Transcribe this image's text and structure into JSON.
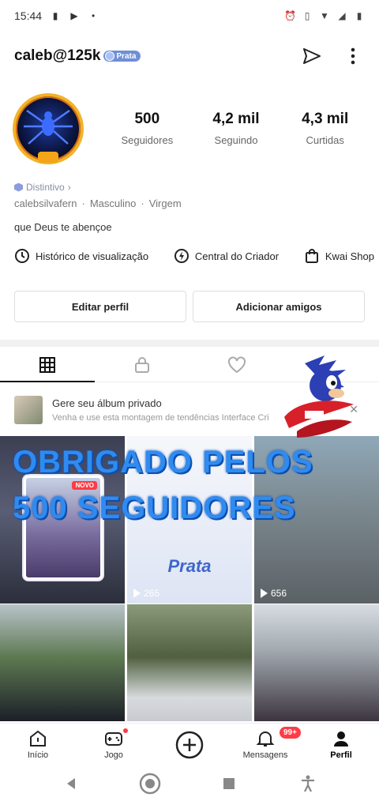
{
  "status_bar": {
    "time": "15:44"
  },
  "header": {
    "username": "caleb@125k",
    "badge": "Prata"
  },
  "stats": [
    {
      "value": "500",
      "label": "Seguidores"
    },
    {
      "value": "4,2 mil",
      "label": "Seguindo"
    },
    {
      "value": "4,3 mil",
      "label": "Curtidas"
    }
  ],
  "profile": {
    "distintivo": "Distintivo",
    "handle": "calebsilvafern",
    "gender": "Masculino",
    "sign": "Virgem",
    "bio": "que Deus te abençoe"
  },
  "shortcuts": {
    "history": "Histórico de visualização",
    "creator": "Central do Criador",
    "shop": "Kwai Shop"
  },
  "actions": {
    "edit": "Editar perfil",
    "add": "Adicionar amigos"
  },
  "album_banner": {
    "title": "Gere seu álbum privado",
    "subtitle": "Venha e use esta montagem de tendências Interface Cri"
  },
  "grid": {
    "videos": [
      {
        "views": ""
      },
      {
        "views": "265"
      },
      {
        "views": "656"
      },
      {
        "views": ""
      },
      {
        "views": ""
      },
      {
        "views": ""
      }
    ],
    "novo_tag": "NOVO",
    "prata_watermark": "Prata"
  },
  "overlay": {
    "line1": "OBRIGADO PELOS",
    "line2": "500 SEGUIDORES"
  },
  "bottom_nav": {
    "items": [
      "Início",
      "Jogo",
      "",
      "Mensagens",
      "Perfil"
    ],
    "messages_badge": "99+"
  }
}
